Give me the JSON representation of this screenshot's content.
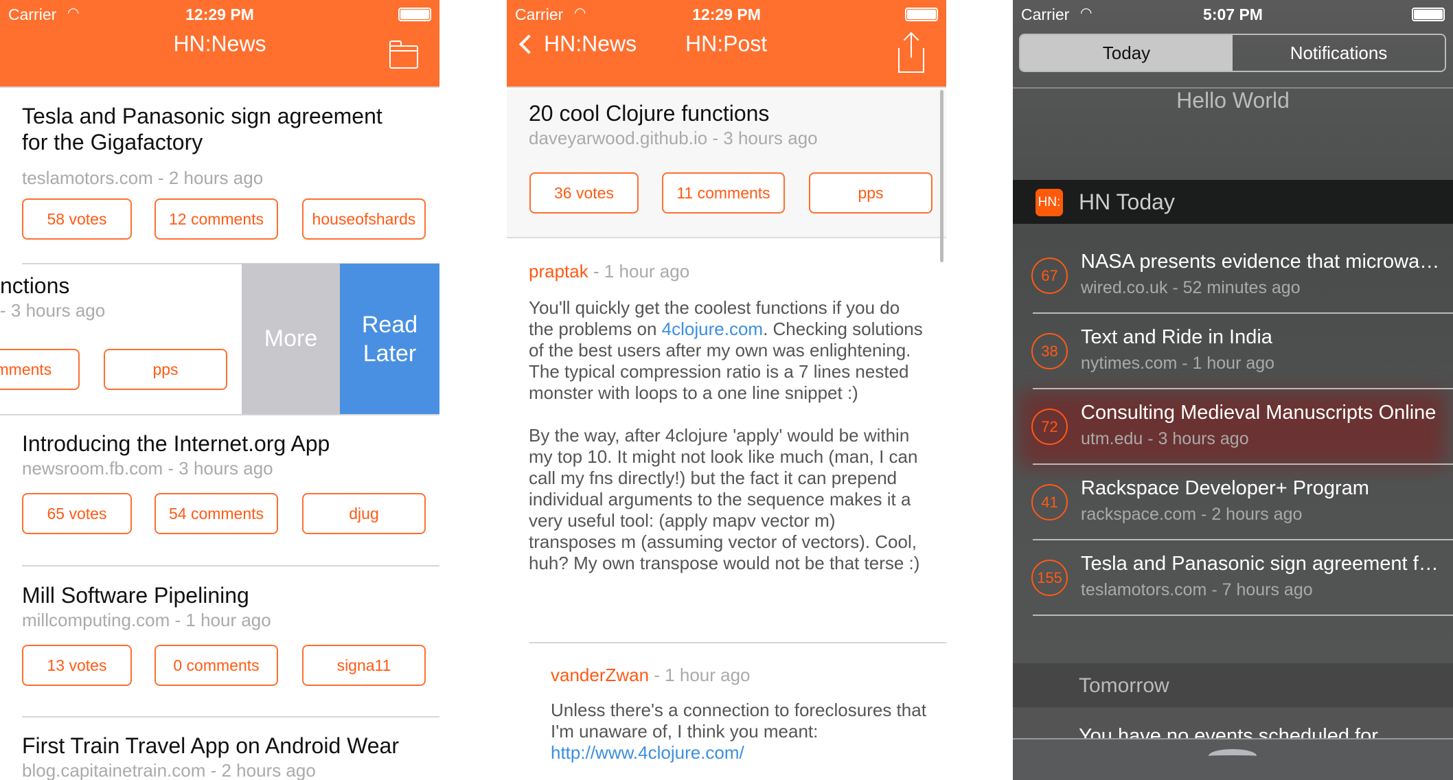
{
  "colors": {
    "accent": "#ff6f2e",
    "read_later": "#4a90e2",
    "more": "#c7c7cc"
  },
  "p1": {
    "status": {
      "carrier": "Carrier",
      "time": "12:29 PM"
    },
    "title": "HN:News",
    "folder_icon": "folder-icon",
    "stories": [
      {
        "title": "Tesla and Panasonic sign agreement for the Gigafactory",
        "meta": "teslamotors.com - 2 hours ago",
        "votes": "58 votes",
        "comments": "12 comments",
        "user": "houseofshards"
      },
      {
        "title": "nctions",
        "meta": "- 3 hours ago",
        "votes": "",
        "comments": "omments",
        "user": "pps"
      },
      {
        "title": "Introducing the Internet.org App",
        "meta": "newsroom.fb.com - 3 hours ago",
        "votes": "65 votes",
        "comments": "54 comments",
        "user": "djug"
      },
      {
        "title": "Mill Software Pipelining",
        "meta": "millcomputing.com - 1 hour ago",
        "votes": "13 votes",
        "comments": "0 comments",
        "user": "signa11"
      },
      {
        "title": "First Train Travel App on Android Wear",
        "meta": "blog.capitainetrain.com - 2 hours ago"
      }
    ],
    "swipe": {
      "more": "More",
      "read_later": "Read Later"
    }
  },
  "p2": {
    "status": {
      "carrier": "Carrier",
      "time": "12:29 PM"
    },
    "back": "HN:News",
    "title": "HN:Post",
    "post": {
      "title": "20 cool Clojure functions",
      "meta": "daveyarwood.github.io - 3 hours ago",
      "votes": "36 votes",
      "comments": "11 comments",
      "user": "pps"
    },
    "comments": [
      {
        "author": "praptak",
        "ago": " - 1 hour ago",
        "p1a": "You'll quickly get the coolest functions if you do the problems on ",
        "link": "4clojure.com",
        "p1b": ". Checking solutions of the best users after my own was enlightening. The typical compression ratio is a 7 lines nested monster with loops to a one line snippet :)",
        "p2": "By the way, after 4clojure 'apply' would be within my top 10. It might not look like much (man, I can call my fns directly!) but the fact it can prepend individual arguments to the sequence makes it a very useful tool: (apply mapv vector m) transposes m (assuming vector of vectors). Cool, huh? My own transpose would not be that terse :)"
      },
      {
        "author": "vanderZwan",
        "ago": " - 1 hour ago",
        "p1a": "Unless there's a connection to foreclosures that I'm unaware of, I think you meant: ",
        "link": "http://www.4clojure.com/"
      }
    ]
  },
  "p3": {
    "status": {
      "carrier": "Carrier",
      "time": "5:07 PM"
    },
    "tabs": {
      "today": "Today",
      "notifications": "Notifications"
    },
    "hello": "Hello World",
    "widget": {
      "icon": "HN:",
      "title": "HN Today"
    },
    "rows": [
      {
        "score": "67",
        "title": "NASA presents evidence that microwave thruster 'impossible' space drive works",
        "meta": "wired.co.uk - 52 minutes ago"
      },
      {
        "score": "38",
        "title": "Text and Ride in India",
        "meta": "nytimes.com - 1 hour ago"
      },
      {
        "score": "72",
        "title": "Consulting Medieval Manuscripts Online",
        "meta": "utm.edu - 3 hours ago"
      },
      {
        "score": "41",
        "title": "Rackspace Developer+ Program",
        "meta": "rackspace.com - 2 hours ago"
      },
      {
        "score": "155",
        "title": "Tesla and Panasonic sign agreement for the Gigafactory",
        "meta": "teslamotors.com - 7 hours ago"
      }
    ],
    "tomorrow": "Tomorrow",
    "no_events": "You have no events scheduled for"
  }
}
